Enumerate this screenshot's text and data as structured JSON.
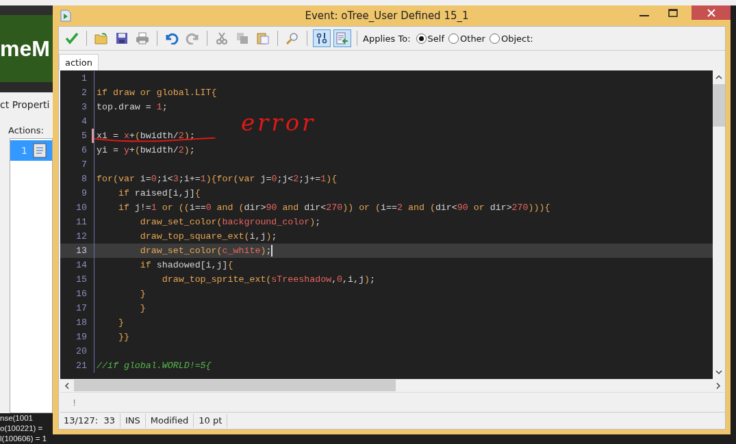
{
  "background": {
    "logo_text": "meM",
    "panel_title": "ct Properti",
    "actions_label": "Actions:",
    "actions": [
      {
        "number": "1",
        "selected": true
      }
    ],
    "console": [
      "nse(1001",
      "o(100221) =",
      "l(100606) = 1"
    ]
  },
  "window": {
    "title": "Event: oTree_User Defined 15_1",
    "toolbar": {
      "view_toggles": [
        {
          "pressed": true
        },
        {
          "pressed": true
        }
      ],
      "applies_to": {
        "label": "Applies To:",
        "options": [
          {
            "label": "Self",
            "selected": true
          },
          {
            "label": "Other",
            "selected": false
          },
          {
            "label": "Object:",
            "selected": false
          }
        ]
      }
    },
    "tabs": [
      {
        "label": "action",
        "selected": true
      }
    ],
    "annotation": "error",
    "code_lines": [
      {
        "number": "1",
        "current": false,
        "marked": false
      },
      {
        "number": "2",
        "current": false,
        "marked": false,
        "tokens": [
          {
            "kind": "keyword",
            "text": "if draw or global.LIT{"
          }
        ]
      },
      {
        "number": "3",
        "current": false,
        "marked": false,
        "tokens": [
          {
            "kind": "plain",
            "text": "top.draw = "
          },
          {
            "kind": "value",
            "text": "1"
          },
          {
            "kind": "plain",
            "text": ";"
          }
        ]
      },
      {
        "number": "4",
        "current": false,
        "marked": false
      },
      {
        "number": "5",
        "current": false,
        "marked": true,
        "tokens": [
          {
            "kind": "plain",
            "text": "xi = "
          },
          {
            "kind": "value",
            "text": "x"
          },
          {
            "kind": "plain",
            "text": "+"
          },
          {
            "kind": "keyword",
            "text": "("
          },
          {
            "kind": "plain",
            "text": "bwidth/"
          },
          {
            "kind": "value",
            "text": "2"
          },
          {
            "kind": "keyword",
            "text": ")"
          },
          {
            "kind": "plain",
            "text": ";"
          }
        ]
      },
      {
        "number": "6",
        "current": false,
        "marked": false,
        "tokens": [
          {
            "kind": "plain",
            "text": "yi = "
          },
          {
            "kind": "value",
            "text": "y"
          },
          {
            "kind": "plain",
            "text": "+"
          },
          {
            "kind": "keyword",
            "text": "("
          },
          {
            "kind": "plain",
            "text": "bwidth/"
          },
          {
            "kind": "value",
            "text": "2"
          },
          {
            "kind": "keyword",
            "text": ")"
          },
          {
            "kind": "plain",
            "text": ";"
          }
        ]
      },
      {
        "number": "7",
        "current": false,
        "marked": false
      },
      {
        "number": "8",
        "current": false,
        "marked": false,
        "tokens": [
          {
            "kind": "keyword",
            "text": "for(var "
          },
          {
            "kind": "plain",
            "text": "i="
          },
          {
            "kind": "value",
            "text": "0"
          },
          {
            "kind": "plain",
            "text": ";i<"
          },
          {
            "kind": "value",
            "text": "3"
          },
          {
            "kind": "plain",
            "text": ";i+="
          },
          {
            "kind": "value",
            "text": "1"
          },
          {
            "kind": "keyword",
            "text": "){for(var "
          },
          {
            "kind": "plain",
            "text": "j="
          },
          {
            "kind": "value",
            "text": "0"
          },
          {
            "kind": "plain",
            "text": ";j<"
          },
          {
            "kind": "value",
            "text": "2"
          },
          {
            "kind": "plain",
            "text": ";j+="
          },
          {
            "kind": "value",
            "text": "1"
          },
          {
            "kind": "keyword",
            "text": "){"
          }
        ]
      },
      {
        "number": "9",
        "current": false,
        "marked": false,
        "tokens": [
          {
            "kind": "keyword",
            "text": "    if "
          },
          {
            "kind": "plain",
            "text": "raised[i,j]"
          },
          {
            "kind": "keyword",
            "text": "{"
          }
        ]
      },
      {
        "number": "10",
        "current": false,
        "marked": false,
        "tokens": [
          {
            "kind": "keyword",
            "text": "    if "
          },
          {
            "kind": "plain",
            "text": "j!="
          },
          {
            "kind": "value",
            "text": "1"
          },
          {
            "kind": "keyword",
            "text": " or (("
          },
          {
            "kind": "plain",
            "text": "i=="
          },
          {
            "kind": "value",
            "text": "0"
          },
          {
            "kind": "keyword",
            "text": " and ("
          },
          {
            "kind": "plain",
            "text": "dir>"
          },
          {
            "kind": "value",
            "text": "90"
          },
          {
            "kind": "keyword",
            "text": " and "
          },
          {
            "kind": "plain",
            "text": "dir<"
          },
          {
            "kind": "value",
            "text": "270"
          },
          {
            "kind": "keyword",
            "text": ")) or ("
          },
          {
            "kind": "plain",
            "text": "i=="
          },
          {
            "kind": "value",
            "text": "2"
          },
          {
            "kind": "keyword",
            "text": " and ("
          },
          {
            "kind": "plain",
            "text": "dir<"
          },
          {
            "kind": "value",
            "text": "90"
          },
          {
            "kind": "keyword",
            "text": " or "
          },
          {
            "kind": "plain",
            "text": "dir>"
          },
          {
            "kind": "value",
            "text": "270"
          },
          {
            "kind": "keyword",
            "text": "))){"
          }
        ]
      },
      {
        "number": "11",
        "current": false,
        "marked": false,
        "tokens": [
          {
            "kind": "keyword",
            "text": "        draw_set_color("
          },
          {
            "kind": "value",
            "text": "background_color"
          },
          {
            "kind": "keyword",
            "text": ")"
          },
          {
            "kind": "plain",
            "text": ";"
          }
        ]
      },
      {
        "number": "12",
        "current": false,
        "marked": false,
        "tokens": [
          {
            "kind": "keyword",
            "text": "        draw_top_square_ext("
          },
          {
            "kind": "plain",
            "text": "i,j"
          },
          {
            "kind": "keyword",
            "text": ")"
          },
          {
            "kind": "plain",
            "text": ";"
          }
        ]
      },
      {
        "number": "13",
        "current": true,
        "marked": false,
        "tokens": [
          {
            "kind": "keyword",
            "text": "        draw_set_color("
          },
          {
            "kind": "value",
            "text": "c_white"
          },
          {
            "kind": "keyword",
            "text": ")"
          },
          {
            "kind": "plain",
            "text": ";"
          }
        ]
      },
      {
        "number": "14",
        "current": false,
        "marked": false,
        "tokens": [
          {
            "kind": "keyword",
            "text": "        if "
          },
          {
            "kind": "plain",
            "text": "shadowed[i,j]"
          },
          {
            "kind": "keyword",
            "text": "{"
          }
        ]
      },
      {
        "number": "15",
        "current": false,
        "marked": false,
        "tokens": [
          {
            "kind": "keyword",
            "text": "            draw_top_sprite_ext("
          },
          {
            "kind": "value",
            "text": "sTreeshadow"
          },
          {
            "kind": "plain",
            "text": ","
          },
          {
            "kind": "value",
            "text": "0"
          },
          {
            "kind": "plain",
            "text": ",i,j"
          },
          {
            "kind": "keyword",
            "text": ")"
          },
          {
            "kind": "plain",
            "text": ";"
          }
        ]
      },
      {
        "number": "16",
        "current": false,
        "marked": false,
        "tokens": [
          {
            "kind": "keyword",
            "text": "        }"
          }
        ]
      },
      {
        "number": "17",
        "current": false,
        "marked": false,
        "tokens": [
          {
            "kind": "keyword",
            "text": "        }"
          }
        ]
      },
      {
        "number": "18",
        "current": false,
        "marked": false,
        "tokens": [
          {
            "kind": "keyword",
            "text": "    }"
          }
        ]
      },
      {
        "number": "19",
        "current": false,
        "marked": false,
        "tokens": [
          {
            "kind": "keyword",
            "text": "    }}"
          }
        ]
      },
      {
        "number": "20",
        "current": false,
        "marked": false
      },
      {
        "number": "21",
        "current": false,
        "marked": false,
        "tokens": [
          {
            "kind": "comment",
            "text": "//if global.WORLD!=5{"
          }
        ]
      }
    ],
    "message": "!",
    "status_bar": [
      "13/127:  33",
      "INS",
      "Modified",
      "10 pt"
    ]
  }
}
